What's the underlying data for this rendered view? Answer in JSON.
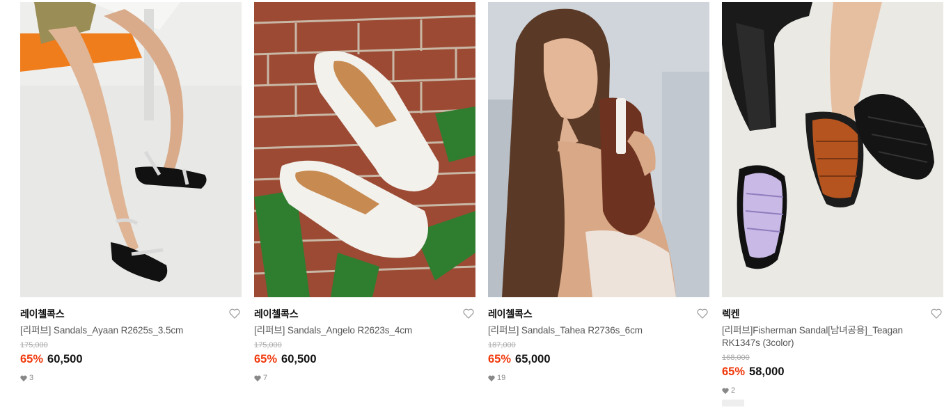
{
  "products": [
    {
      "brand": "레이첼콕스",
      "name": "[리퍼브] Sandals_Ayaan R2625s_3.5cm",
      "original_price": "175,000",
      "discount_rate": "65%",
      "price": "60,500",
      "likes": "3",
      "photo_icon": "sandal-photo-icon"
    },
    {
      "brand": "레이첼콕스",
      "name": "[리퍼브] Sandals_Angelo R2623s_4cm",
      "original_price": "175,000",
      "discount_rate": "65%",
      "price": "60,500",
      "likes": "7",
      "photo_icon": "sandal-photo-icon"
    },
    {
      "brand": "레이첼콕스",
      "name": "[리퍼브] Sandals_Tahea R2736s_6cm",
      "original_price": "187,000",
      "discount_rate": "65%",
      "price": "65,000",
      "likes": "19",
      "photo_icon": "sandal-photo-icon"
    },
    {
      "brand": "렉켄",
      "name": "[리퍼브]Fisherman Sandal[남녀공용]_Teagan RK1347s (3color)",
      "original_price": "168,000",
      "discount_rate": "65%",
      "price": "58,000",
      "likes": "2",
      "photo_icon": "sandal-photo-icon"
    }
  ],
  "colors": {
    "discount": "#f0380b",
    "original_price": "#aaaaaa",
    "text": "#111111"
  }
}
